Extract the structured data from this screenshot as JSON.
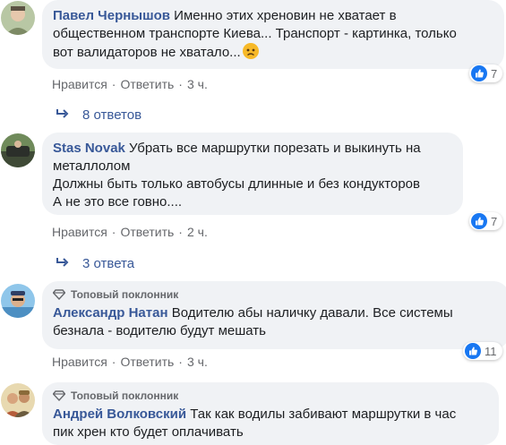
{
  "comments": [
    {
      "author": "Павел Чернышов",
      "text": "Именно этих хреновин не хватает в\nобщественном транспорте Киева... Транспорт - картинка, только\nвот валидаторов не хватало...",
      "emoji": "sad-face",
      "like_label": "Нравится",
      "reply_label": "Ответить",
      "time": "3 ч.",
      "reactions": "7",
      "replies": "8 ответов",
      "badge": ""
    },
    {
      "author": "Stas Novak",
      "text": "Убрать все маршрутки порезать и выкинуть на\nметаллолом\nДолжны быть только автобусы длинные и без кондукторов\nА не это все говно....",
      "like_label": "Нравится",
      "reply_label": "Ответить",
      "time": "2 ч.",
      "reactions": "7",
      "replies": "3 ответа",
      "badge": ""
    },
    {
      "author": "Александр Натан",
      "text": "Водителю абы наличку давали. Все системы\nбезнала - водителю будут мешать",
      "like_label": "Нравится",
      "reply_label": "Ответить",
      "time": "3 ч.",
      "reactions": "11",
      "badge": "Топовый поклонник"
    },
    {
      "author": "Андрей Волковский",
      "text": "Так как водилы забивают маршрутки в час\nпик хрен кто будет оплачивать",
      "badge": "Топовый поклонник"
    }
  ],
  "separator": "·",
  "colors": {
    "author": "#385898",
    "bubble": "#f0f2f5",
    "like": "#1877f2",
    "meta": "#65676b"
  }
}
